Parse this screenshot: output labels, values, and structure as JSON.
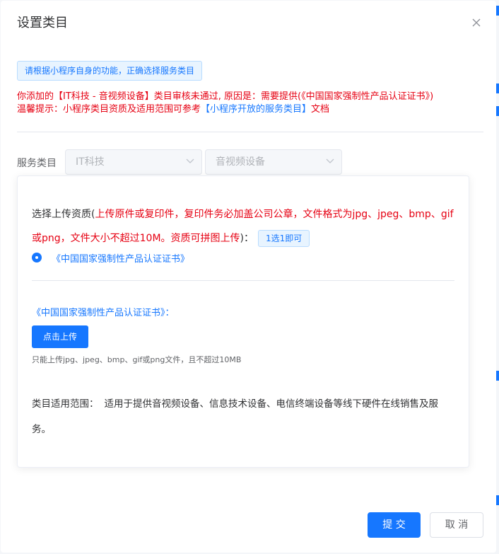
{
  "dialog": {
    "title": "设置类目",
    "tip": "请根据小程序自身的功能，正确选择服务类目",
    "reject_line1": "你添加的【IT科技 - 音视频设备】类目审核未通过, 原因是：需要提供(《中国国家强制性产品认证证书》)",
    "reject_line2_prefix": "温馨提示：小程序类目资质及适用范围可参考",
    "reject_line2_link": "【小程序开放的服务类目】",
    "reject_line2_suffix": "文档"
  },
  "service": {
    "label": "服务类目",
    "category1": "IT科技",
    "category2": "音视频设备"
  },
  "upload_panel": {
    "req_prefix": "选择上传资质(",
    "req_red": "上传原件或复印件，复印件务必加盖公司公章，文件格式为jpg、jpeg、bmp、gif或png，文件大小不超过10M。资质可拼图上传",
    "req_suffix": ")：",
    "badge": "1选1即可",
    "radio_option": "《中国国家强制性产品认证证书》",
    "upload_title": "《中国国家强制性产品认证证书》：",
    "upload_button": "点击上传",
    "upload_hint": "只能上传jpg、jpeg、bmp、gif或png文件，且不超过10MB",
    "scope_label": "类目适用范围：",
    "scope_text": "适用于提供音视频设备、信息技术设备、电信终端设备等线下硬件在线销售及服务。"
  },
  "footer": {
    "submit": "提 交",
    "cancel": "取 消"
  },
  "colors": {
    "primary": "#1677ff",
    "error": "#e60012"
  }
}
